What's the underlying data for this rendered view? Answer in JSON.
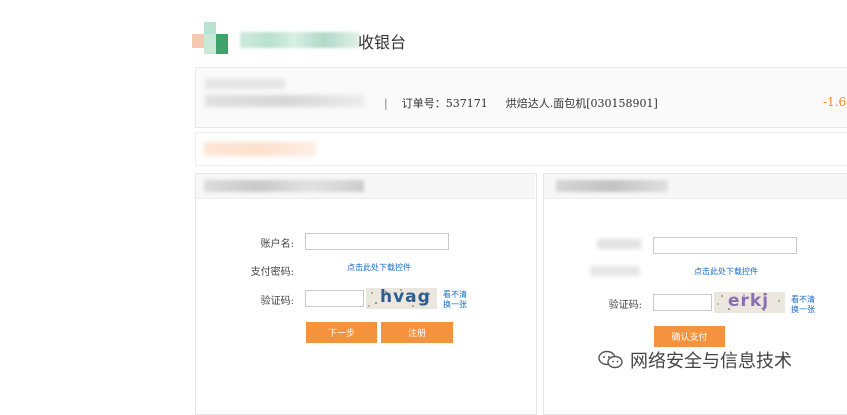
{
  "header": {
    "title_suffix": "收银台",
    "logo_icon": "blurred-logo-icon"
  },
  "order": {
    "separator": "|",
    "order_no_label": "订单号：",
    "order_no": "537171",
    "product": "烘焙达人.面包机[030158901]",
    "amount": "-1.6"
  },
  "left_form": {
    "account_label": "账户名:",
    "password_label": "支付密码:",
    "download_link": "点击此处下载控件",
    "captcha_label": "验证码:",
    "captcha_text": "hvag",
    "refresh_line1": "看不清",
    "refresh_line2": "换一张",
    "next_button": "下一步",
    "register_button": "注册"
  },
  "right_form": {
    "download_link": "点击此处下载控件",
    "captcha_label": "验证码:",
    "captcha_text": "erkj",
    "refresh_line1": "看不清",
    "refresh_line2": "换一张",
    "confirm_button": "确认支付"
  },
  "watermark": {
    "text": "网络安全与信息技术",
    "icon": "wechat-official-account-icon"
  },
  "colors": {
    "accent": "#f5923e",
    "amount": "#f08a2c",
    "link": "#1a6cc4"
  }
}
